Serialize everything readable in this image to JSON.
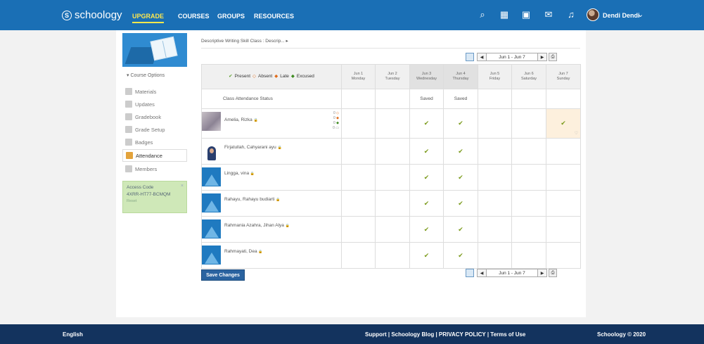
{
  "header": {
    "logo": "schoology",
    "logo_mark": "S",
    "nav": [
      "UPGRADE",
      "COURSES",
      "GROUPS",
      "RESOURCES"
    ],
    "icons": [
      "search-icon",
      "apps-icon",
      "calendar-icon",
      "messages-icon",
      "notifications-icon"
    ],
    "user_name": "Dendi Dendi"
  },
  "sidebar": {
    "course_options": "▾ Course Options",
    "items": [
      "Materials",
      "Updates",
      "Gradebook",
      "Grade Setup",
      "Badges",
      "Attendance",
      "Members"
    ],
    "active_item": "Attendance",
    "access_code_label": "Access Code",
    "access_code": "4XRR-HT77-BCMQM",
    "reset_label": "Reset"
  },
  "main": {
    "breadcrumb": "Descriptive Writing Skill Class : Descrip... ▸",
    "date_range": "Jun 1 - Jun 7",
    "legend": {
      "present": "Present",
      "absent": "Absent",
      "late": "Late",
      "excused": "Excused"
    },
    "days": [
      {
        "date": "Jun 1",
        "day": "Monday"
      },
      {
        "date": "Jun 2",
        "day": "Tuesday"
      },
      {
        "date": "Jun 3",
        "day": "Wednesday"
      },
      {
        "date": "Jun 4",
        "day": "Thursday"
      },
      {
        "date": "Jun 5",
        "day": "Friday"
      },
      {
        "date": "Jun 6",
        "day": "Saturday"
      },
      {
        "date": "Jun 7",
        "day": "Sunday"
      }
    ],
    "status_label": "Class Attendance Status",
    "status": [
      "",
      "",
      "Saved",
      "Saved",
      "",
      "",
      ""
    ],
    "students": [
      {
        "name": "Amelia, Rizka",
        "marks": [
          "",
          "",
          "✔",
          "✔",
          "",
          "",
          "✔"
        ]
      },
      {
        "name": "Firjatullah, Cahyarani ayu",
        "marks": [
          "",
          "",
          "✔",
          "✔",
          "",
          "",
          ""
        ]
      },
      {
        "name": "Lingga, vina",
        "marks": [
          "",
          "",
          "✔",
          "✔",
          "",
          "",
          ""
        ]
      },
      {
        "name": "Rahayu, Rahayu budiarti",
        "marks": [
          "",
          "",
          "✔",
          "✔",
          "",
          "",
          ""
        ]
      },
      {
        "name": "Rahmania Azahra, Jihan Alya",
        "marks": [
          "",
          "",
          "✔",
          "✔",
          "",
          "",
          ""
        ]
      },
      {
        "name": "Rahmayati, Dea",
        "marks": [
          "",
          "",
          "✔",
          "✔",
          "",
          "",
          ""
        ]
      }
    ],
    "save_button": "Save Changes"
  },
  "footer": {
    "language": "English",
    "links": "Support  |  Schoology Blog  |  PRIVACY POLICY  |  Terms of Use",
    "copyright": "Schoology © 2020"
  },
  "colors": {
    "header": "#1a6fb5",
    "footer": "#13335e",
    "upgrade": "#ffe84d",
    "present": "#5a9e28",
    "absent": "#e06b19",
    "access_box": "#cfe8b8"
  }
}
